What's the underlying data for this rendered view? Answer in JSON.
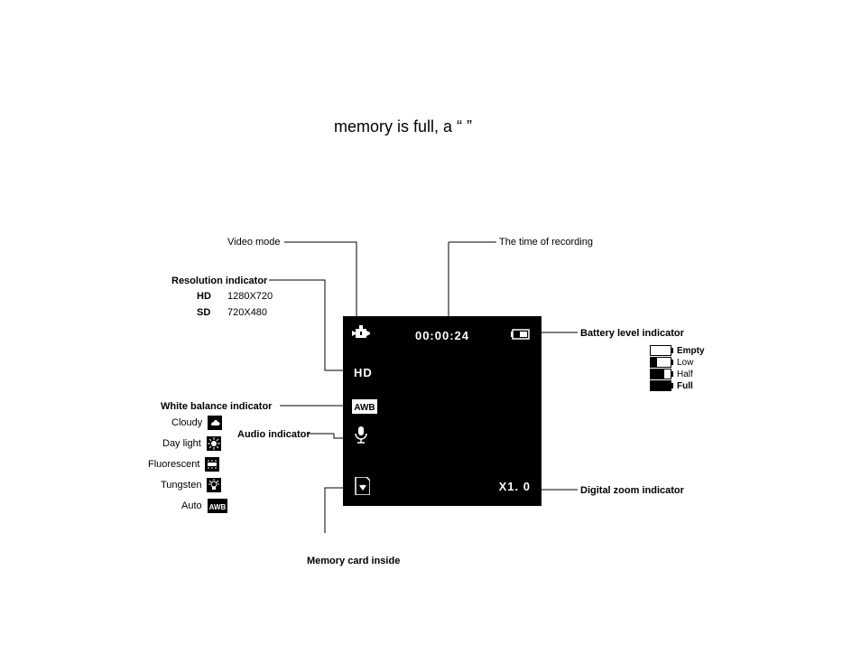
{
  "top_text": "memory is full, a “                       ”",
  "screen": {
    "timer": "00:00:24",
    "resolution": "HD",
    "awb": "AWB",
    "zoom": "X1. 0"
  },
  "labels": {
    "video_mode": "Video mode",
    "resolution_indicator": "Resolution indicator",
    "res_hd": "HD",
    "res_hd_val": "1280X720",
    "res_sd": "SD",
    "res_sd_val": "720X480",
    "wb_indicator": "White balance indicator",
    "wb_cloudy": "Cloudy",
    "wb_daylight": "Day light",
    "wb_fluorescent": "Fluorescent",
    "wb_tungsten": "Tungsten",
    "wb_auto": "Auto",
    "audio_indicator": "Audio indicator",
    "memory_card": "Memory card inside",
    "time_recording": "The time of recording",
    "battery_indicator": "Battery level indicator",
    "battery_empty": "Empty",
    "battery_low": "Low",
    "battery_half": "Half",
    "battery_full": "Full",
    "zoom_indicator": "Digital zoom indicator"
  }
}
